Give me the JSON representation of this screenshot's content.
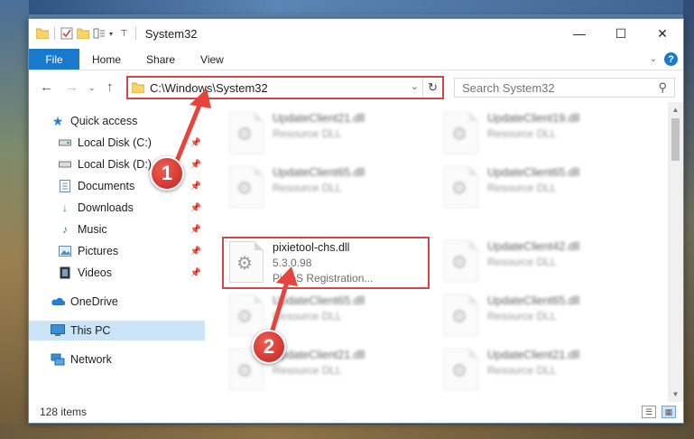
{
  "window": {
    "title": "System32",
    "controls": {
      "minimize": "—",
      "maximize": "☐",
      "close": "✕"
    }
  },
  "ribbon": {
    "tabs": [
      "File",
      "Home",
      "Share",
      "View"
    ],
    "help": "?"
  },
  "address": {
    "path": "C:\\Windows\\System32",
    "search_placeholder": "Search System32"
  },
  "nav_pane": {
    "items": [
      {
        "label": "Quick access",
        "icon": "star-icon",
        "pinned": false
      },
      {
        "label": "Local Disk (C:)",
        "icon": "drive-icon",
        "pinned": true
      },
      {
        "label": "Local Disk (D:)",
        "icon": "drive-icon",
        "pinned": true
      },
      {
        "label": "Documents",
        "icon": "documents-icon",
        "pinned": true
      },
      {
        "label": "Downloads",
        "icon": "download-icon",
        "pinned": true
      },
      {
        "label": "Music",
        "icon": "music-icon",
        "pinned": true
      },
      {
        "label": "Pictures",
        "icon": "pictures-icon",
        "pinned": true
      },
      {
        "label": "Videos",
        "icon": "videos-icon",
        "pinned": true
      },
      {
        "label": "OneDrive",
        "icon": "onedrive-icon",
        "pinned": false
      },
      {
        "label": "This PC",
        "icon": "computer-icon",
        "pinned": false,
        "selected": true
      },
      {
        "label": "Network",
        "icon": "network-icon",
        "pinned": false
      }
    ]
  },
  "files": [
    {
      "name": "UpdateClient21.dll",
      "sub": "Resource DLL",
      "blurred": true
    },
    {
      "name": "UpdateClient19.dll",
      "sub": "Resource DLL",
      "blurred": true
    },
    {
      "name": "UpdateClient65.dll",
      "sub": "Resource DLL",
      "blurred": true
    },
    {
      "name": "UpdateClient65.dll",
      "sub": "Resource DLL",
      "blurred": true
    },
    {
      "name": "pixietool-chs.dll",
      "version": "5.3.0.98",
      "sub": "PixieS Registration...",
      "blurred": false,
      "highlighted": true
    },
    {
      "name": "UpdateClient42.dll",
      "sub": "Resource DLL",
      "blurred": true
    },
    {
      "name": "UpdateClient65.dll",
      "sub": "Resource DLL",
      "blurred": true
    },
    {
      "name": "UpdateClient65.dll",
      "sub": "Resource DLL",
      "blurred": true
    },
    {
      "name": "UpdateClient21.dll",
      "sub": "Resource DLL",
      "blurred": true
    },
    {
      "name": "UpdateClient21.dll",
      "sub": "Resource DLL",
      "blurred": true
    }
  ],
  "status": {
    "item_count": "128 items"
  },
  "annotations": {
    "step1": "1",
    "step2": "2",
    "color": "#d64545"
  }
}
